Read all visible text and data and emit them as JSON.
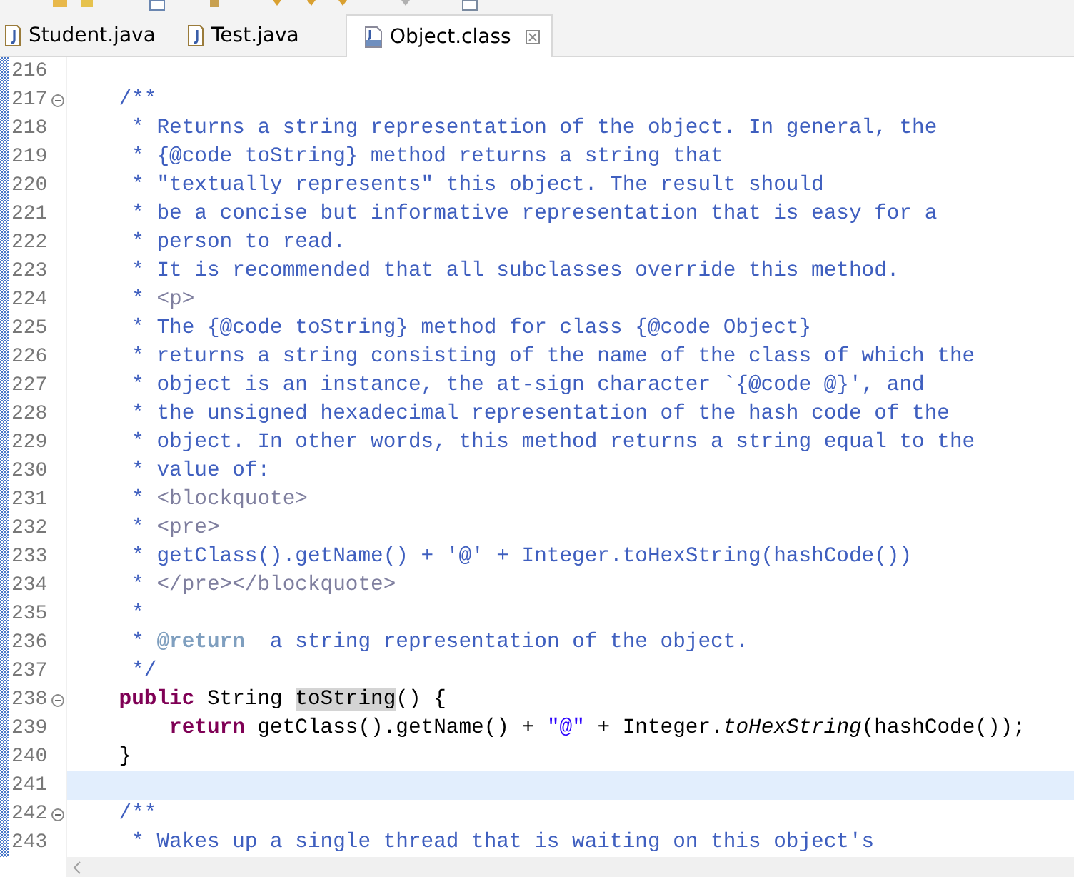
{
  "tabs": [
    {
      "label": "Student.java",
      "kind": "java",
      "selected": false
    },
    {
      "label": "Test.java",
      "kind": "java",
      "selected": false
    },
    {
      "label": "Object.class",
      "kind": "class",
      "selected": true
    }
  ],
  "editor": {
    "lines": [
      {
        "number": "216",
        "foldable": false,
        "current": false
      },
      {
        "number": "217",
        "foldable": true,
        "current": false,
        "segments": [
          {
            "kind": "doc",
            "text": "    /**"
          }
        ]
      },
      {
        "number": "218",
        "foldable": false,
        "current": false,
        "segments": [
          {
            "kind": "doc",
            "text": "     * Returns a string representation of the object. In general, the"
          }
        ]
      },
      {
        "number": "219",
        "foldable": false,
        "current": false,
        "segments": [
          {
            "kind": "doc",
            "text": "     * {@code toString} method returns a string that"
          }
        ]
      },
      {
        "number": "220",
        "foldable": false,
        "current": false,
        "segments": [
          {
            "kind": "doc",
            "text": "     * \"textually represents\" this object. The result should"
          }
        ]
      },
      {
        "number": "221",
        "foldable": false,
        "current": false,
        "segments": [
          {
            "kind": "doc",
            "text": "     * be a concise but informative representation that is easy for a"
          }
        ]
      },
      {
        "number": "222",
        "foldable": false,
        "current": false,
        "segments": [
          {
            "kind": "doc",
            "text": "     * person to read."
          }
        ]
      },
      {
        "number": "223",
        "foldable": false,
        "current": false,
        "segments": [
          {
            "kind": "doc",
            "text": "     * It is recommended that all subclasses override this method."
          }
        ]
      },
      {
        "number": "224",
        "foldable": false,
        "current": false,
        "segments": [
          {
            "kind": "doc",
            "text": "     * "
          },
          {
            "kind": "tag",
            "text": "<p>"
          }
        ]
      },
      {
        "number": "225",
        "foldable": false,
        "current": false,
        "segments": [
          {
            "kind": "doc",
            "text": "     * The {@code toString} method for class {@code Object}"
          }
        ]
      },
      {
        "number": "226",
        "foldable": false,
        "current": false,
        "segments": [
          {
            "kind": "doc",
            "text": "     * returns a string consisting of the name of the class of which the"
          }
        ]
      },
      {
        "number": "227",
        "foldable": false,
        "current": false,
        "segments": [
          {
            "kind": "doc",
            "text": "     * object is an instance, the at-sign character `{@code @}', and"
          }
        ]
      },
      {
        "number": "228",
        "foldable": false,
        "current": false,
        "segments": [
          {
            "kind": "doc",
            "text": "     * the unsigned hexadecimal representation of the hash code of the"
          }
        ]
      },
      {
        "number": "229",
        "foldable": false,
        "current": false,
        "segments": [
          {
            "kind": "doc",
            "text": "     * object. In other words, this method returns a string equal to the"
          }
        ]
      },
      {
        "number": "230",
        "foldable": false,
        "current": false,
        "segments": [
          {
            "kind": "doc",
            "text": "     * value of:"
          }
        ]
      },
      {
        "number": "231",
        "foldable": false,
        "current": false,
        "segments": [
          {
            "kind": "doc",
            "text": "     * "
          },
          {
            "kind": "tag",
            "text": "<blockquote>"
          }
        ]
      },
      {
        "number": "232",
        "foldable": false,
        "current": false,
        "segments": [
          {
            "kind": "doc",
            "text": "     * "
          },
          {
            "kind": "tag",
            "text": "<pre>"
          }
        ]
      },
      {
        "number": "233",
        "foldable": false,
        "current": false,
        "segments": [
          {
            "kind": "doc",
            "text": "     * getClass().getName() + '@' + Integer.toHexString(hashCode())"
          }
        ]
      },
      {
        "number": "234",
        "foldable": false,
        "current": false,
        "segments": [
          {
            "kind": "doc",
            "text": "     * "
          },
          {
            "kind": "tag",
            "text": "</pre></blockquote>"
          }
        ]
      },
      {
        "number": "235",
        "foldable": false,
        "current": false,
        "segments": [
          {
            "kind": "doc",
            "text": "     *"
          }
        ]
      },
      {
        "number": "236",
        "foldable": false,
        "current": false,
        "segments": [
          {
            "kind": "doc",
            "text": "     * "
          },
          {
            "kind": "doctag",
            "text": "@return"
          },
          {
            "kind": "doc",
            "text": "  a string representation of the object."
          }
        ]
      },
      {
        "number": "237",
        "foldable": false,
        "current": false,
        "segments": [
          {
            "kind": "doc",
            "text": "     */"
          }
        ]
      },
      {
        "number": "238",
        "foldable": true,
        "current": false,
        "segments": [
          {
            "kind": "keyword",
            "text": "    public"
          },
          {
            "kind": "plain",
            "text": " String "
          },
          {
            "kind": "occurrence",
            "text": "toString"
          },
          {
            "kind": "plain",
            "text": "() {"
          }
        ]
      },
      {
        "number": "239",
        "foldable": false,
        "current": false,
        "segments": [
          {
            "kind": "keyword",
            "text": "        return"
          },
          {
            "kind": "plain",
            "text": " getClass().getName() + "
          },
          {
            "kind": "string",
            "text": "\"@\""
          },
          {
            "kind": "plain",
            "text": " + Integer."
          },
          {
            "kind": "static",
            "text": "toHexString"
          },
          {
            "kind": "plain",
            "text": "(hashCode());"
          }
        ]
      },
      {
        "number": "240",
        "foldable": false,
        "current": false,
        "segments": [
          {
            "kind": "plain",
            "text": "    }"
          }
        ]
      },
      {
        "number": "241",
        "foldable": false,
        "current": true
      },
      {
        "number": "242",
        "foldable": true,
        "current": false,
        "segments": [
          {
            "kind": "doc",
            "text": "    /**"
          }
        ]
      },
      {
        "number": "243",
        "foldable": false,
        "current": false,
        "segments": [
          {
            "kind": "doc",
            "text": "     * Wakes up a single thread that is waiting on this object's"
          }
        ]
      }
    ]
  }
}
